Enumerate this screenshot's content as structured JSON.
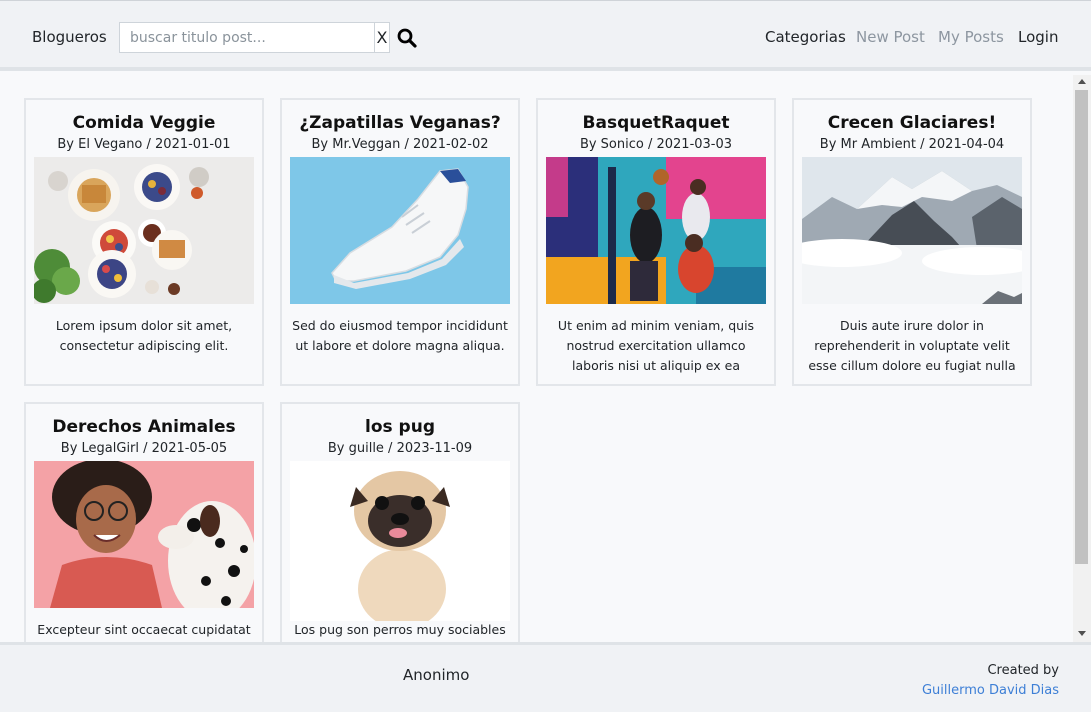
{
  "header": {
    "brand": "Blogueros",
    "search_placeholder": "buscar titulo post...",
    "search_value": "",
    "clear_label": "X",
    "search_icon": "search-icon",
    "nav": {
      "categorias": "Categorias",
      "new_post": "New Post",
      "my_posts": "My Posts",
      "login": "Login"
    }
  },
  "posts": [
    {
      "title": "Comida Veggie",
      "meta": "By El Vegano / 2021-01-01",
      "excerpt": "Lorem ipsum dolor sit amet, consectetur adipiscing elit.",
      "image": "food-spread-photo"
    },
    {
      "title": "¿Zapatillas Veganas?",
      "meta": "By Mr.Veggan / 2021-02-02",
      "excerpt": "Sed do eiusmod tempor incididunt ut labore et dolore magna aliqua.",
      "image": "white-sneaker-photo"
    },
    {
      "title": "BasquetRaquet",
      "meta": "By Sonico / 2021-03-03",
      "excerpt": "Ut enim ad minim veniam, quis nostrud exercitation ullamco laboris nisi ut aliquip ex ea",
      "image": "basketball-players-photo"
    },
    {
      "title": "Crecen Glaciares!",
      "meta": "By Mr Ambient / 2021-04-04",
      "excerpt": "Duis aute irure dolor in reprehenderit in voluptate velit esse cillum dolore eu fugiat nulla",
      "image": "snowy-mountains-photo"
    },
    {
      "title": "Derechos Animales",
      "meta": "By LegalGirl / 2021-05-05",
      "excerpt": "Excepteur sint occaecat cupidatat",
      "image": "woman-with-dalmatian-photo"
    },
    {
      "title": "los pug",
      "meta": "By guille / 2023-11-09",
      "excerpt": "Los pug son perros muy sociables y",
      "image": "pug-photo"
    }
  ],
  "footer": {
    "center": "Anonimo",
    "created_by": "Created by",
    "author": "Guillermo David Dias"
  },
  "colors": {
    "header_bg": "#f0f2f5",
    "page_bg": "#f8f9fb",
    "muted_nav": "#8d96a0",
    "link_blue": "#3d7fd6"
  }
}
